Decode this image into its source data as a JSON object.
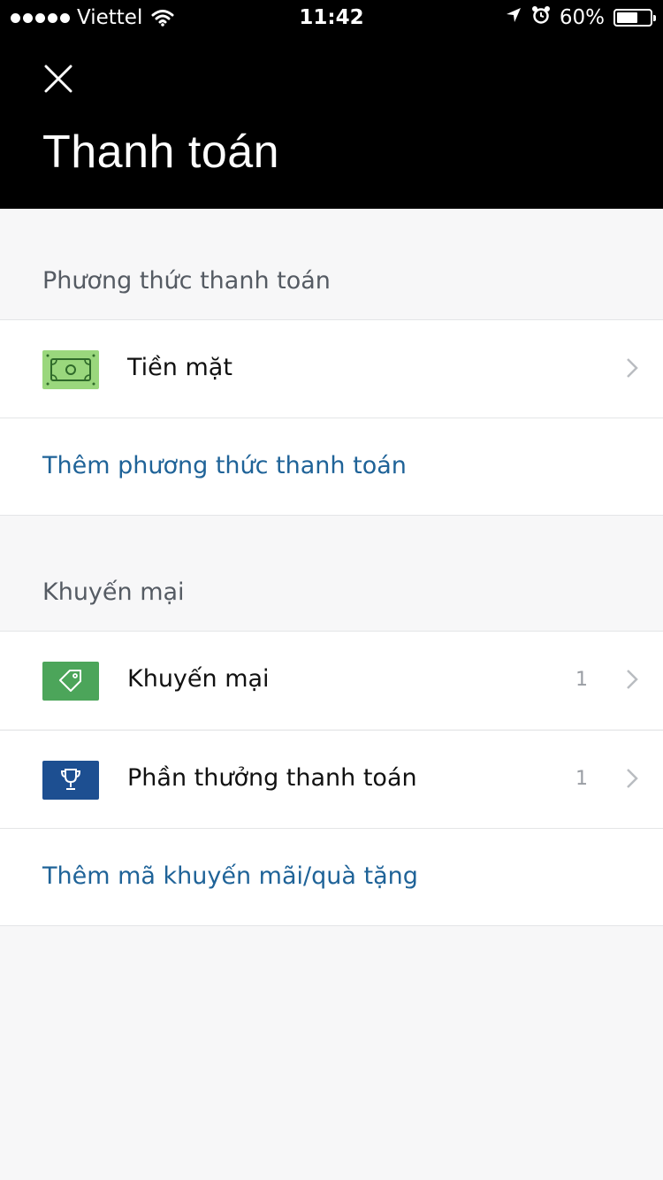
{
  "status_bar": {
    "carrier": "Viettel",
    "time": "11:42",
    "battery": "60%"
  },
  "header": {
    "title": "Thanh toán",
    "close_icon": "close-icon"
  },
  "payment_section": {
    "header": "Phương thức thanh toán",
    "methods": [
      {
        "label": "Tiền mặt",
        "icon": "cash-icon",
        "icon_color": "#9ad77d"
      }
    ],
    "add_label": "Thêm phương thức thanh toán"
  },
  "promo_section": {
    "header": "Khuyến mại",
    "items": [
      {
        "label": "Khuyến mại",
        "count": "1",
        "icon": "tag-icon",
        "icon_color": "#4ca55a"
      },
      {
        "label": "Phần thưởng thanh toán",
        "count": "1",
        "icon": "trophy-icon",
        "icon_color": "#1d4f91"
      }
    ],
    "add_label": "Thêm mã khuyến mãi/quà tặng"
  },
  "colors": {
    "header_bg": "#000000",
    "link": "#1f6398",
    "page_bg": "#f7f7f8"
  }
}
